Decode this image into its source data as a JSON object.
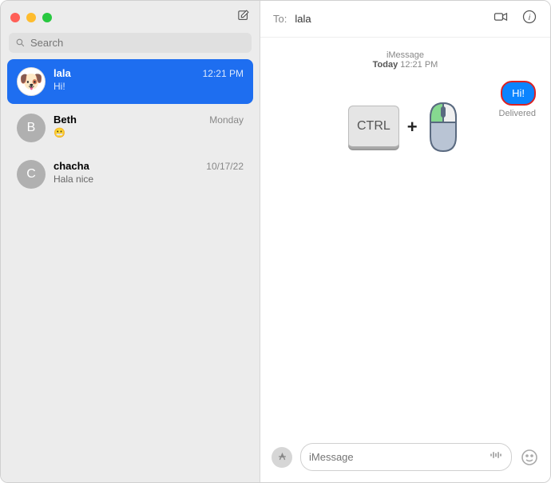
{
  "sidebar": {
    "search_placeholder": "Search",
    "conversations": [
      {
        "name": "lala",
        "time": "12:21 PM",
        "preview": "Hi!",
        "avatar": "dog",
        "letter": "🐶",
        "selected": true
      },
      {
        "name": "Beth",
        "time": "Monday",
        "preview": "😬",
        "avatar": "grey",
        "letter": "B",
        "selected": false
      },
      {
        "name": "chacha",
        "time": "10/17/22",
        "preview": "Hala nice",
        "avatar": "grey",
        "letter": "C",
        "selected": false
      }
    ]
  },
  "header": {
    "to_label": "To:",
    "to_name": "lala"
  },
  "chat": {
    "service": "iMessage",
    "day": "Today",
    "time": "12:21 PM",
    "bubble_text": "Hi!",
    "status": "Delivered"
  },
  "overlay": {
    "key_label": "CTRL"
  },
  "compose": {
    "placeholder": "iMessage"
  }
}
